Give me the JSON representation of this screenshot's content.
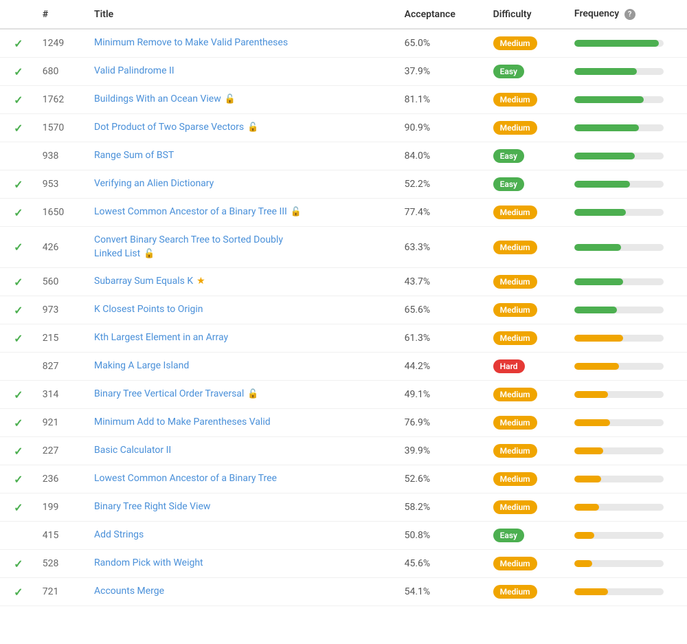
{
  "header": {
    "col_check": "",
    "col_num": "#",
    "col_title": "Title",
    "col_accept": "Acceptance",
    "col_diff": "Difficulty",
    "col_freq": "Frequency",
    "freq_help": "?"
  },
  "rows": [
    {
      "checked": true,
      "num": "1249",
      "title": "Minimum Remove to Make Valid Parentheses",
      "title2": "",
      "lock": false,
      "star": false,
      "acceptance": "65.0%",
      "difficulty": "Medium",
      "freq_pct": 95,
      "freq_color": "green"
    },
    {
      "checked": true,
      "num": "680",
      "title": "Valid Palindrome II",
      "title2": "",
      "lock": false,
      "star": false,
      "acceptance": "37.9%",
      "difficulty": "Easy",
      "freq_pct": 70,
      "freq_color": "green"
    },
    {
      "checked": true,
      "num": "1762",
      "title": "Buildings With an Ocean View",
      "title2": "",
      "lock": true,
      "star": false,
      "acceptance": "81.1%",
      "difficulty": "Medium",
      "freq_pct": 78,
      "freq_color": "green"
    },
    {
      "checked": true,
      "num": "1570",
      "title": "Dot Product of Two Sparse Vectors",
      "title2": "",
      "lock": true,
      "star": false,
      "acceptance": "90.9%",
      "difficulty": "Medium",
      "freq_pct": 72,
      "freq_color": "green"
    },
    {
      "checked": false,
      "num": "938",
      "title": "Range Sum of BST",
      "title2": "",
      "lock": false,
      "star": false,
      "acceptance": "84.0%",
      "difficulty": "Easy",
      "freq_pct": 68,
      "freq_color": "green"
    },
    {
      "checked": true,
      "num": "953",
      "title": "Verifying an Alien Dictionary",
      "title2": "",
      "lock": false,
      "star": false,
      "acceptance": "52.2%",
      "difficulty": "Easy",
      "freq_pct": 62,
      "freq_color": "green"
    },
    {
      "checked": true,
      "num": "1650",
      "title": "Lowest Common Ancestor of a Binary Tree III",
      "title2": "",
      "lock": true,
      "star": false,
      "acceptance": "77.4%",
      "difficulty": "Medium",
      "freq_pct": 58,
      "freq_color": "green"
    },
    {
      "checked": true,
      "num": "426",
      "title": "Convert Binary Search Tree to Sorted Doubly",
      "title2": "Linked List",
      "lock": true,
      "star": false,
      "acceptance": "63.3%",
      "difficulty": "Medium",
      "freq_pct": 52,
      "freq_color": "green"
    },
    {
      "checked": true,
      "num": "560",
      "title": "Subarray Sum Equals K",
      "title2": "",
      "lock": false,
      "star": true,
      "acceptance": "43.7%",
      "difficulty": "Medium",
      "freq_pct": 55,
      "freq_color": "green"
    },
    {
      "checked": true,
      "num": "973",
      "title": "K Closest Points to Origin",
      "title2": "",
      "lock": false,
      "star": false,
      "acceptance": "65.6%",
      "difficulty": "Medium",
      "freq_pct": 48,
      "freq_color": "green"
    },
    {
      "checked": true,
      "num": "215",
      "title": "Kth Largest Element in an Array",
      "title2": "",
      "lock": false,
      "star": false,
      "acceptance": "61.3%",
      "difficulty": "Medium",
      "freq_pct": 55,
      "freq_color": "yellow"
    },
    {
      "checked": false,
      "num": "827",
      "title": "Making A Large Island",
      "title2": "",
      "lock": false,
      "star": false,
      "acceptance": "44.2%",
      "difficulty": "Hard",
      "freq_pct": 50,
      "freq_color": "yellow"
    },
    {
      "checked": true,
      "num": "314",
      "title": "Binary Tree Vertical Order Traversal",
      "title2": "",
      "lock": true,
      "star": false,
      "acceptance": "49.1%",
      "difficulty": "Medium",
      "freq_pct": 38,
      "freq_color": "yellow"
    },
    {
      "checked": true,
      "num": "921",
      "title": "Minimum Add to Make Parentheses Valid",
      "title2": "",
      "lock": false,
      "star": false,
      "acceptance": "76.9%",
      "difficulty": "Medium",
      "freq_pct": 40,
      "freq_color": "yellow"
    },
    {
      "checked": true,
      "num": "227",
      "title": "Basic Calculator II",
      "title2": "",
      "lock": false,
      "star": false,
      "acceptance": "39.9%",
      "difficulty": "Medium",
      "freq_pct": 32,
      "freq_color": "yellow"
    },
    {
      "checked": true,
      "num": "236",
      "title": "Lowest Common Ancestor of a Binary Tree",
      "title2": "",
      "lock": false,
      "star": false,
      "acceptance": "52.6%",
      "difficulty": "Medium",
      "freq_pct": 30,
      "freq_color": "yellow"
    },
    {
      "checked": true,
      "num": "199",
      "title": "Binary Tree Right Side View",
      "title2": "",
      "lock": false,
      "star": false,
      "acceptance": "58.2%",
      "difficulty": "Medium",
      "freq_pct": 28,
      "freq_color": "yellow"
    },
    {
      "checked": false,
      "num": "415",
      "title": "Add Strings",
      "title2": "",
      "lock": false,
      "star": false,
      "acceptance": "50.8%",
      "difficulty": "Easy",
      "freq_pct": 22,
      "freq_color": "yellow"
    },
    {
      "checked": true,
      "num": "528",
      "title": "Random Pick with Weight",
      "title2": "",
      "lock": false,
      "star": false,
      "acceptance": "45.6%",
      "difficulty": "Medium",
      "freq_pct": 20,
      "freq_color": "yellow"
    },
    {
      "checked": true,
      "num": "721",
      "title": "Accounts Merge",
      "title2": "",
      "lock": false,
      "star": false,
      "acceptance": "54.1%",
      "difficulty": "Medium",
      "freq_pct": 38,
      "freq_color": "yellow"
    }
  ]
}
